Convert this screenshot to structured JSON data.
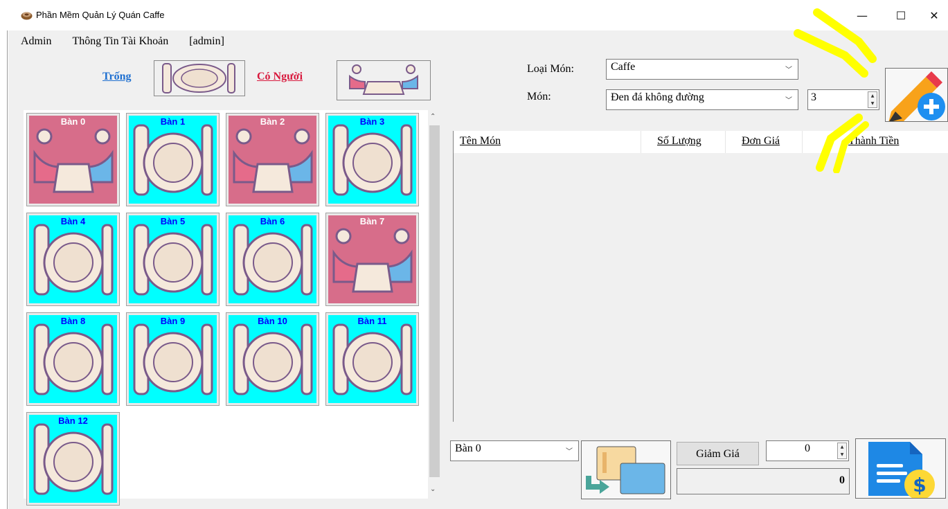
{
  "window": {
    "title": "Phần Mềm Quản Lý Quán Caffe",
    "minimize": "—",
    "maximize": "☐",
    "close": "✕"
  },
  "menu": {
    "admin": "Admin",
    "account_info": "Thông Tin Tài Khoản",
    "user": "[admin]"
  },
  "legend": {
    "empty": "Trống",
    "occupied": "Có Người"
  },
  "tables": [
    {
      "label": "Bàn 0",
      "status": "occupied"
    },
    {
      "label": "Bàn 1",
      "status": "empty"
    },
    {
      "label": "Bàn 2",
      "status": "occupied"
    },
    {
      "label": "Bàn 3",
      "status": "empty"
    },
    {
      "label": "Bàn 4",
      "status": "empty"
    },
    {
      "label": "Bàn 5",
      "status": "empty"
    },
    {
      "label": "Bàn 6",
      "status": "empty"
    },
    {
      "label": "Bàn 7",
      "status": "occupied"
    },
    {
      "label": "Bàn 8",
      "status": "empty"
    },
    {
      "label": "Bàn 9",
      "status": "empty"
    },
    {
      "label": "Bàn 10",
      "status": "empty"
    },
    {
      "label": "Bàn 11",
      "status": "empty"
    },
    {
      "label": "Bàn 12",
      "status": "empty"
    }
  ],
  "order": {
    "category_label": "Loại Món:",
    "category_value": "Caffe",
    "item_label": "Món:",
    "item_value": "Đen đá không đường",
    "quantity": "3"
  },
  "bill_columns": {
    "name": "Tên Món",
    "qty": "Số Lượng",
    "price": "Đơn Giá",
    "total": "Thành Tiền"
  },
  "footer": {
    "switch_table_value": "Bàn 0",
    "discount_button": "Giảm Giá",
    "discount_value": "0",
    "total_value": "0"
  },
  "colors": {
    "empty": "#00ffff",
    "occupied": "#d76d8a",
    "annotation": "#ffff00"
  }
}
